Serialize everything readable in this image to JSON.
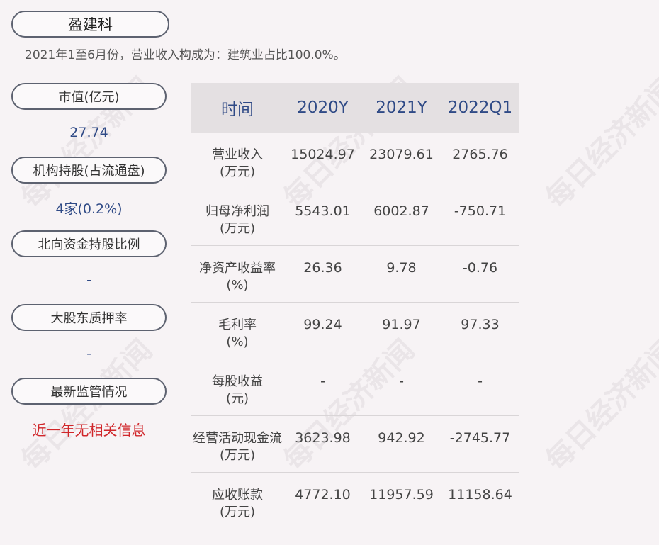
{
  "company": "盈建科",
  "summary": "2021年1至6月份，营业收入构成为：建筑业占比100.0%。",
  "sidebar": [
    {
      "label": "市值(亿元)",
      "value": "27.74"
    },
    {
      "label": "机构持股(占流通盘)",
      "value": "4家(0.2%)"
    },
    {
      "label": "北向资金持股比例",
      "value": "-"
    },
    {
      "label": "大股东质押率",
      "value": "-"
    },
    {
      "label": "最新监管情况",
      "value": "近一年无相关信息"
    }
  ],
  "table": {
    "headers": [
      "时间",
      "2020Y",
      "2021Y",
      "2022Q1"
    ],
    "rows": [
      {
        "label1": "营业收入",
        "label2": "(万元)",
        "v": [
          "15024.97",
          "23079.61",
          "2765.76"
        ]
      },
      {
        "label1": "归母净利润",
        "label2": "(万元)",
        "v": [
          "5543.01",
          "6002.87",
          "-750.71"
        ]
      },
      {
        "label1": "净资产收益率",
        "label2": "(%)",
        "v": [
          "26.36",
          "9.78",
          "-0.76"
        ]
      },
      {
        "label1": "毛利率",
        "label2": "(%)",
        "v": [
          "99.24",
          "91.97",
          "97.33"
        ]
      },
      {
        "label1": "每股收益",
        "label2": "(元)",
        "v": [
          "-",
          "-",
          "-"
        ]
      },
      {
        "label1": "经营活动现金流",
        "label2": "(万元)",
        "v": [
          "3623.98",
          "942.92",
          "-2745.77"
        ]
      },
      {
        "label1": "应收账款",
        "label2": "(万元)",
        "v": [
          "4772.10",
          "11957.59",
          "11158.64"
        ]
      }
    ]
  },
  "watermark": "每日经济新闻"
}
